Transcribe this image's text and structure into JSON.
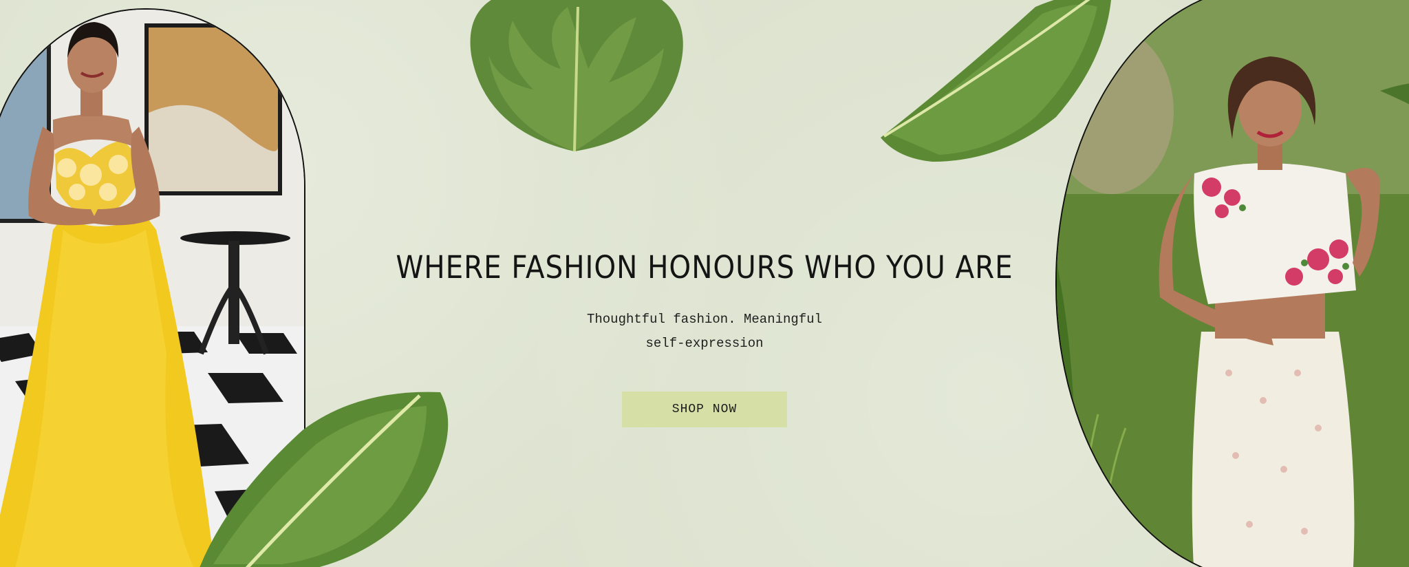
{
  "hero": {
    "headline": "WHERE FASHION HONOURS WHO YOU ARE",
    "subtitle_line1": "Thoughtful fashion. Meaningful",
    "subtitle_line2": "self-expression",
    "cta_label": "SHOP NOW"
  },
  "colors": {
    "background": "#dde3cf",
    "button": "#d6e0a6",
    "text": "#141414"
  },
  "images": [
    {
      "name": "model-yellow-gown-photo",
      "alt": "model in yellow gown"
    },
    {
      "name": "model-white-floral-outfit-photo",
      "alt": "model in white floral outfit"
    }
  ]
}
